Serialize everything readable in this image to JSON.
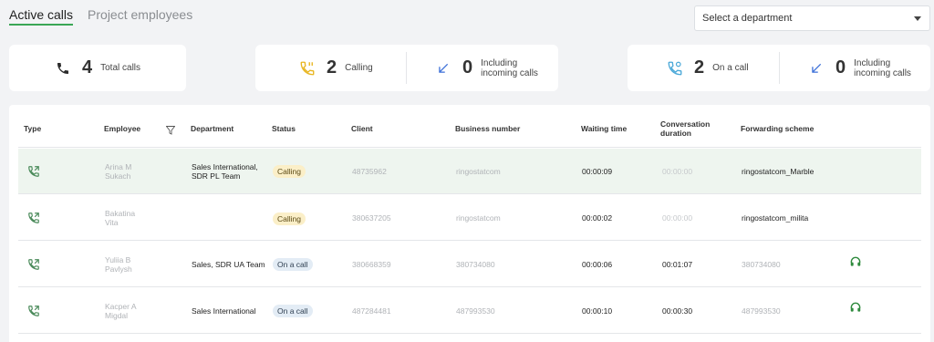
{
  "tabs": [
    {
      "label": "Active calls",
      "active": true
    },
    {
      "label": "Project employees",
      "active": false
    }
  ],
  "department_select": {
    "placeholder": "Select a department"
  },
  "stats": {
    "total_calls": {
      "value": "4",
      "label": "Total calls",
      "icon": "phone-icon"
    },
    "calling": {
      "value": "2",
      "label": "Calling",
      "icon": "ringing-phone-icon"
    },
    "calling_incoming": {
      "value": "0",
      "label_line1": "Including",
      "label_line2": "incoming calls",
      "icon": "incoming-arrow-icon"
    },
    "on_a_call": {
      "value": "2",
      "label": "On a call",
      "icon": "phone-active-icon"
    },
    "on_call_incoming": {
      "value": "0",
      "label_line1": "Including",
      "label_line2": "incoming calls",
      "icon": "incoming-arrow-icon"
    }
  },
  "table": {
    "headers": {
      "type": "Type",
      "employee": "Employee",
      "department": "Department",
      "status": "Status",
      "client": "Client",
      "business_number": "Business number",
      "waiting_time": "Waiting time",
      "conversation_line1": "Conversation",
      "conversation_line2": "duration",
      "forwarding_scheme": "Forwarding scheme"
    },
    "rows": [
      {
        "employee_line1": "Arina M",
        "employee_line2": "Sukach",
        "department_line1": "Sales International,",
        "department_line2": "SDR PL Team",
        "status": "Calling",
        "client": "48735962",
        "business_number": "ringostatcom",
        "waiting_time": "00:00:09",
        "conversation": "00:00:00",
        "forwarding": "ringostatcom_Marble",
        "headset": false
      },
      {
        "employee_line1": "Bakatina",
        "employee_line2": "Vita",
        "department_line1": "",
        "department_line2": "",
        "status": "Calling",
        "client": "380637205",
        "business_number": "ringostatcom",
        "waiting_time": "00:00:02",
        "conversation": "00:00:00",
        "forwarding": "ringostatcom_milita",
        "headset": false
      },
      {
        "employee_line1": "Yuliia B",
        "employee_line2": "Pavlysh",
        "department_line1": "Sales, SDR UA Team",
        "department_line2": "",
        "status": "On a call",
        "client": "380668359",
        "business_number": "380734080",
        "waiting_time": "00:00:06",
        "conversation": "00:01:07",
        "forwarding": "380734080",
        "headset": true
      },
      {
        "employee_line1": "Kacper A",
        "employee_line2": "Migdal",
        "department_line1": "Sales International",
        "department_line2": "",
        "status": "On a call",
        "client": "487284481",
        "business_number": "487993530",
        "waiting_time": "00:00:10",
        "conversation": "00:00:30",
        "forwarding": "487993530",
        "headset": true
      }
    ]
  },
  "colors": {
    "accent_green": "#3aa655",
    "calling_badge": "#fbefc8",
    "oncall_badge": "#e3ecf5",
    "incoming_arrow": "#3b6fd8",
    "ringing_yellow": "#e8b51e",
    "active_call_blue": "#4aa8d8"
  }
}
